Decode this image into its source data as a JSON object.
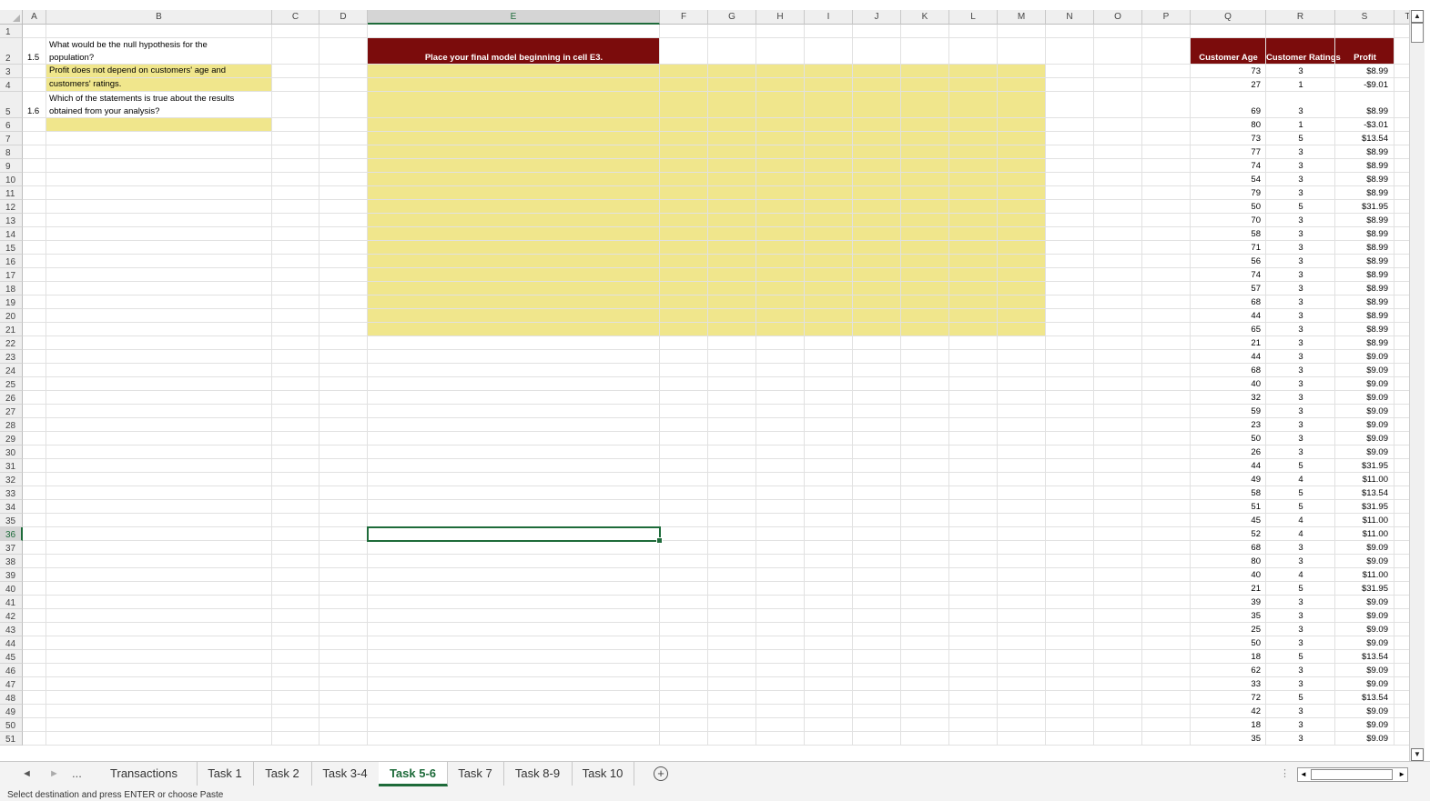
{
  "sheet": {
    "columns": [
      "A",
      "B",
      "C",
      "D",
      "E",
      "F",
      "G",
      "H",
      "I",
      "J",
      "K",
      "L",
      "M",
      "N",
      "O",
      "P",
      "Q",
      "R",
      "S",
      "T"
    ],
    "rows": [
      "1",
      "2",
      "3",
      "4",
      "5",
      "6",
      "7",
      "8",
      "9",
      "10",
      "11",
      "12",
      "13",
      "14",
      "15",
      "16",
      "17",
      "18",
      "19",
      "20",
      "21",
      "22",
      "23",
      "24",
      "25",
      "26",
      "27",
      "28",
      "29",
      "30",
      "31",
      "32",
      "33",
      "34",
      "35",
      "36",
      "37",
      "38",
      "39",
      "40",
      "41",
      "42",
      "43",
      "44",
      "45",
      "46",
      "47",
      "48",
      "49",
      "50",
      "51"
    ],
    "active_column": "E",
    "active_row": "36"
  },
  "questions": {
    "q15_number": "1.5",
    "q15_text_line1": "What would be the null hypothesis for the",
    "q15_text_line2": "population?",
    "q15_answer_line1": "Profit does not depend on customers' age and",
    "q15_answer_line2": "customers' ratings.",
    "q16_number": "1.6",
    "q16_text_line1": "Which of the statements is true about the results",
    "q16_text_line2": "obtained from your analysis?"
  },
  "model_box": {
    "header": "Place your final model beginning in cell E3."
  },
  "table": {
    "headers": [
      "Customer Age",
      "Customer Ratings",
      "Profit"
    ],
    "rows": [
      [
        "73",
        "3",
        "$8.99"
      ],
      [
        "27",
        "1",
        "-$9.01"
      ],
      [
        "69",
        "3",
        "$8.99"
      ],
      [
        "80",
        "1",
        "-$3.01"
      ],
      [
        "73",
        "5",
        "$13.54"
      ],
      [
        "77",
        "3",
        "$8.99"
      ],
      [
        "74",
        "3",
        "$8.99"
      ],
      [
        "54",
        "3",
        "$8.99"
      ],
      [
        "79",
        "3",
        "$8.99"
      ],
      [
        "50",
        "5",
        "$31.95"
      ],
      [
        "70",
        "3",
        "$8.99"
      ],
      [
        "58",
        "3",
        "$8.99"
      ],
      [
        "71",
        "3",
        "$8.99"
      ],
      [
        "56",
        "3",
        "$8.99"
      ],
      [
        "74",
        "3",
        "$8.99"
      ],
      [
        "57",
        "3",
        "$8.99"
      ],
      [
        "68",
        "3",
        "$8.99"
      ],
      [
        "44",
        "3",
        "$8.99"
      ],
      [
        "65",
        "3",
        "$8.99"
      ],
      [
        "21",
        "3",
        "$8.99"
      ],
      [
        "44",
        "3",
        "$9.09"
      ],
      [
        "68",
        "3",
        "$9.09"
      ],
      [
        "40",
        "3",
        "$9.09"
      ],
      [
        "32",
        "3",
        "$9.09"
      ],
      [
        "59",
        "3",
        "$9.09"
      ],
      [
        "23",
        "3",
        "$9.09"
      ],
      [
        "50",
        "3",
        "$9.09"
      ],
      [
        "26",
        "3",
        "$9.09"
      ],
      [
        "44",
        "5",
        "$31.95"
      ],
      [
        "49",
        "4",
        "$11.00"
      ],
      [
        "58",
        "5",
        "$13.54"
      ],
      [
        "51",
        "5",
        "$31.95"
      ],
      [
        "45",
        "4",
        "$11.00"
      ],
      [
        "52",
        "4",
        "$11.00"
      ],
      [
        "68",
        "3",
        "$9.09"
      ],
      [
        "80",
        "3",
        "$9.09"
      ],
      [
        "40",
        "4",
        "$11.00"
      ],
      [
        "21",
        "5",
        "$31.95"
      ],
      [
        "39",
        "3",
        "$9.09"
      ],
      [
        "35",
        "3",
        "$9.09"
      ],
      [
        "25",
        "3",
        "$9.09"
      ],
      [
        "50",
        "3",
        "$9.09"
      ],
      [
        "18",
        "5",
        "$13.54"
      ],
      [
        "62",
        "3",
        "$9.09"
      ],
      [
        "33",
        "3",
        "$9.09"
      ],
      [
        "72",
        "5",
        "$13.54"
      ],
      [
        "42",
        "3",
        "$9.09"
      ],
      [
        "18",
        "3",
        "$9.09"
      ],
      [
        "35",
        "3",
        "$9.09"
      ]
    ]
  },
  "tabs": {
    "nav_prev": "◄",
    "nav_next": "►",
    "more": "...",
    "sheets": [
      "Transactions",
      "Task 1",
      "Task 2",
      "Task 3-4",
      "Task 5-6",
      "Task 7",
      "Task 8-9",
      "Task 10"
    ],
    "active": "Task 5-6",
    "add_sheet": "+"
  },
  "status": {
    "message": "Select destination and press ENTER or choose Paste"
  }
}
